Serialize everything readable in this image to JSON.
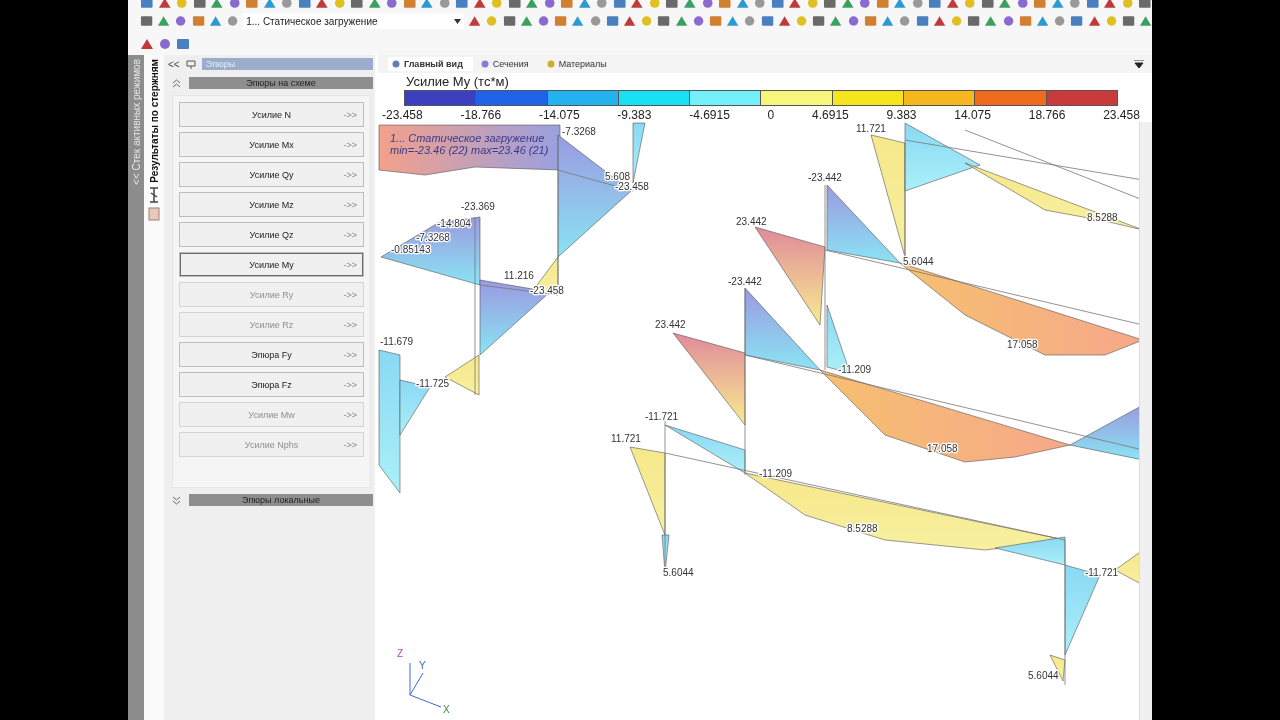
{
  "toolbar": {
    "load_case_select": {
      "value": "1... Статическое загружение"
    }
  },
  "side_tabs": [
    {
      "label": "<< Стек активных режимов",
      "selected": false
    },
    {
      "label": "Результаты по стержням",
      "selected": true
    }
  ],
  "panel": {
    "nav_back": "<<",
    "title": "Эпюры",
    "sections": [
      {
        "title": "Эпюры на схеме",
        "expanded": true,
        "buttons": [
          {
            "label": "Усилие N",
            "arrow": "->>",
            "disabled": false,
            "selected": false
          },
          {
            "label": "Усилие Mx",
            "arrow": "->>",
            "disabled": false,
            "selected": false
          },
          {
            "label": "Усилие Qy",
            "arrow": "->>",
            "disabled": false,
            "selected": false
          },
          {
            "label": "Усилие Mz",
            "arrow": "->>",
            "disabled": false,
            "selected": false
          },
          {
            "label": "Усилие Qz",
            "arrow": "->>",
            "disabled": false,
            "selected": false
          },
          {
            "label": "Усилие My",
            "arrow": "->>",
            "disabled": false,
            "selected": true
          },
          {
            "label": "Усилие Ry",
            "arrow": "->>",
            "disabled": true,
            "selected": false
          },
          {
            "label": "Усилие Rz",
            "arrow": "->>",
            "disabled": true,
            "selected": false
          },
          {
            "label": "Эпюра Fy",
            "arrow": "->>",
            "disabled": false,
            "selected": false
          },
          {
            "label": "Эпюра Fz",
            "arrow": "->>",
            "disabled": false,
            "selected": false
          },
          {
            "label": "Усилие Mw",
            "arrow": "->>",
            "disabled": true,
            "selected": false
          },
          {
            "label": "Усилие Nphs",
            "arrow": "->>",
            "disabled": true,
            "selected": false
          }
        ]
      },
      {
        "title": "Эпюры локальные",
        "expanded": false
      }
    ]
  },
  "view_tabs": [
    {
      "label": "Главный вид",
      "selected": true
    },
    {
      "label": "Сечения",
      "selected": false
    },
    {
      "label": "Материалы",
      "selected": false
    }
  ],
  "legend": {
    "title": "Усилие My (тс*м)",
    "swatches": [
      {
        "color": "#3b3fc0"
      },
      {
        "color": "#1f62e8"
      },
      {
        "color": "#22b2f0"
      },
      {
        "color": "#18e0f5"
      },
      {
        "color": "#72eff8"
      },
      {
        "color": "#f6f57c"
      },
      {
        "color": "#f6e41c"
      },
      {
        "color": "#f6b81c"
      },
      {
        "color": "#f06a1c"
      },
      {
        "color": "#c93a3a"
      }
    ],
    "ticks": [
      "-23.458",
      "-18.766",
      "-14.075",
      "-9.383",
      "-4.6915",
      "0",
      "4.6915",
      "9.383",
      "14.075",
      "18.766",
      "23.458"
    ]
  },
  "diagram": {
    "overlay": [
      "1... Статическое загружение",
      "min=-23.46 (22) max=23.46 (21)"
    ],
    "labels": [
      "11.721",
      "-7.3268",
      "5.608",
      "-23.458",
      "-23.442",
      "-23.369",
      "-14.804",
      "23.442",
      "-7.3268",
      "-0.85143",
      "5.6044",
      "8.5288",
      "11.216",
      "-23.458",
      "-23.442",
      "23.442",
      "17.058",
      "-11.679",
      "-11.209",
      "-11.725",
      "-11.721",
      "17.058",
      "11.721",
      "-11.209",
      "8.5288",
      "5.6044",
      "-11.721",
      "5.6044"
    ],
    "axes": [
      "Z",
      "Y",
      "X"
    ]
  }
}
